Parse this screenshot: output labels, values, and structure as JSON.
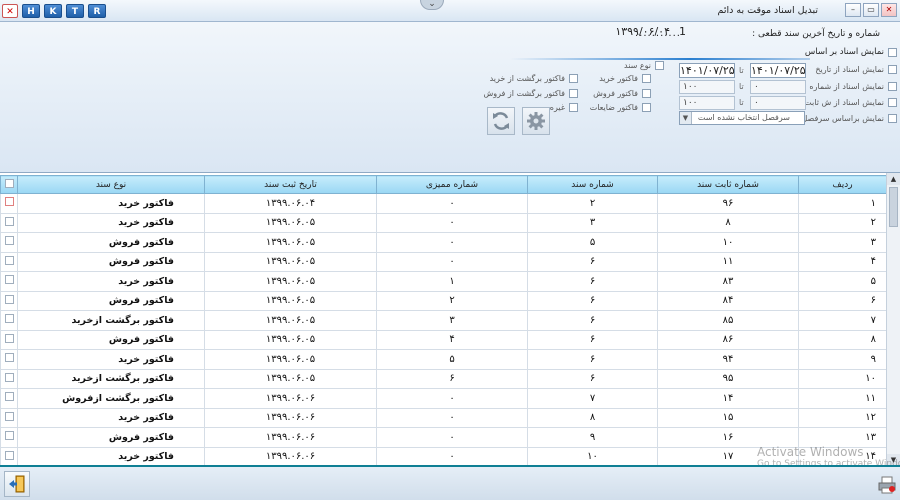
{
  "window": {
    "title": "تبدیل اسناد موقت به دائم",
    "toolbar_letters": [
      "H",
      "K",
      "T",
      "R"
    ]
  },
  "header": {
    "last_doc_label": "شماره و تاریخ آخرین سند قطعی :",
    "last_doc_number": "1",
    "last_doc_date": "۱۳۹۹/۰۶/۰۴",
    "last_doc_dots": "..........."
  },
  "filters": {
    "show_based_on": "نمایش اسناد بر اساس",
    "by_date_label": "نمایش اسناد از تاریخ",
    "date_from": "۱۴۰۱/۰۷/۲۵",
    "date_to": "۱۴۰۱/۰۷/۲۵",
    "date_sep": "تا",
    "by_number_label": "نمایش اسناد از شماره",
    "number_from": "۰",
    "number_to": "۱۰۰",
    "by_fixed_label": "نمایش اسناد از ش ثابت",
    "fixed_from": "۰",
    "fixed_to": "۱۰۰",
    "by_heading_label": "نمایش براساس سرفصل",
    "heading_placeholder": "سرفصل انتخاب نشده است"
  },
  "doc_types": {
    "title": "نوع سند",
    "items": [
      "فاکتور خرید",
      "فاکتور فروش",
      "فاکتور ضایعات",
      "فاکتور برگشت از خرید",
      "فاکتور برگشت از فروش",
      "غیره"
    ]
  },
  "table": {
    "columns": [
      "ردیف",
      "شماره ثابت سند",
      "شماره سند",
      "شماره ممیزی",
      "تاریخ ثبت سند",
      "نوع سند"
    ],
    "rows": [
      [
        "۱",
        "۹۶",
        "۲",
        "۰",
        "۱۳۹۹.۰۶.۰۴",
        "فاکتور خرید"
      ],
      [
        "۲",
        "۸",
        "۳",
        "۰",
        "۱۳۹۹.۰۶.۰۵",
        "فاکتور خرید"
      ],
      [
        "۳",
        "۱۰",
        "۵",
        "۰",
        "۱۳۹۹.۰۶.۰۵",
        "فاکتور فروش"
      ],
      [
        "۴",
        "۱۱",
        "۶",
        "۰",
        "۱۳۹۹.۰۶.۰۵",
        "فاکتور فروش"
      ],
      [
        "۵",
        "۸۳",
        "۶",
        "۱",
        "۱۳۹۹.۰۶.۰۵",
        "فاکتور خرید"
      ],
      [
        "۶",
        "۸۴",
        "۶",
        "۲",
        "۱۳۹۹.۰۶.۰۵",
        "فاکتور فروش"
      ],
      [
        "۷",
        "۸۵",
        "۶",
        "۳",
        "۱۳۹۹.۰۶.۰۵",
        "فاکتور برگشت ازخرید"
      ],
      [
        "۸",
        "۸۶",
        "۶",
        "۴",
        "۱۳۹۹.۰۶.۰۵",
        "فاکتور فروش"
      ],
      [
        "۹",
        "۹۴",
        "۶",
        "۵",
        "۱۳۹۹.۰۶.۰۵",
        "فاکتور خرید"
      ],
      [
        "۱۰",
        "۹۵",
        "۶",
        "۶",
        "۱۳۹۹.۰۶.۰۵",
        "فاکتور برگشت ازخرید"
      ],
      [
        "۱۱",
        "۱۴",
        "۷",
        "۰",
        "۱۳۹۹.۰۶.۰۶",
        "فاکتور برگشت ازفروش"
      ],
      [
        "۱۲",
        "۱۵",
        "۸",
        "۰",
        "۱۳۹۹.۰۶.۰۶",
        "فاکتور خرید"
      ],
      [
        "۱۳",
        "۱۶",
        "۹",
        "۰",
        "۱۳۹۹.۰۶.۰۶",
        "فاکتور فروش"
      ],
      [
        "۱۴",
        "۱۷",
        "۱۰",
        "۰",
        "۱۳۹۹.۰۶.۰۶",
        "فاکتور خرید"
      ]
    ]
  },
  "watermark": {
    "line1": "Activate Windows",
    "line2": "Go to Settings to activate Windows."
  },
  "colors": {
    "header_cyan": "#9ad7f4",
    "toolbar_blue": "#1f5fa8",
    "bottom_border": "#0f7f94"
  }
}
